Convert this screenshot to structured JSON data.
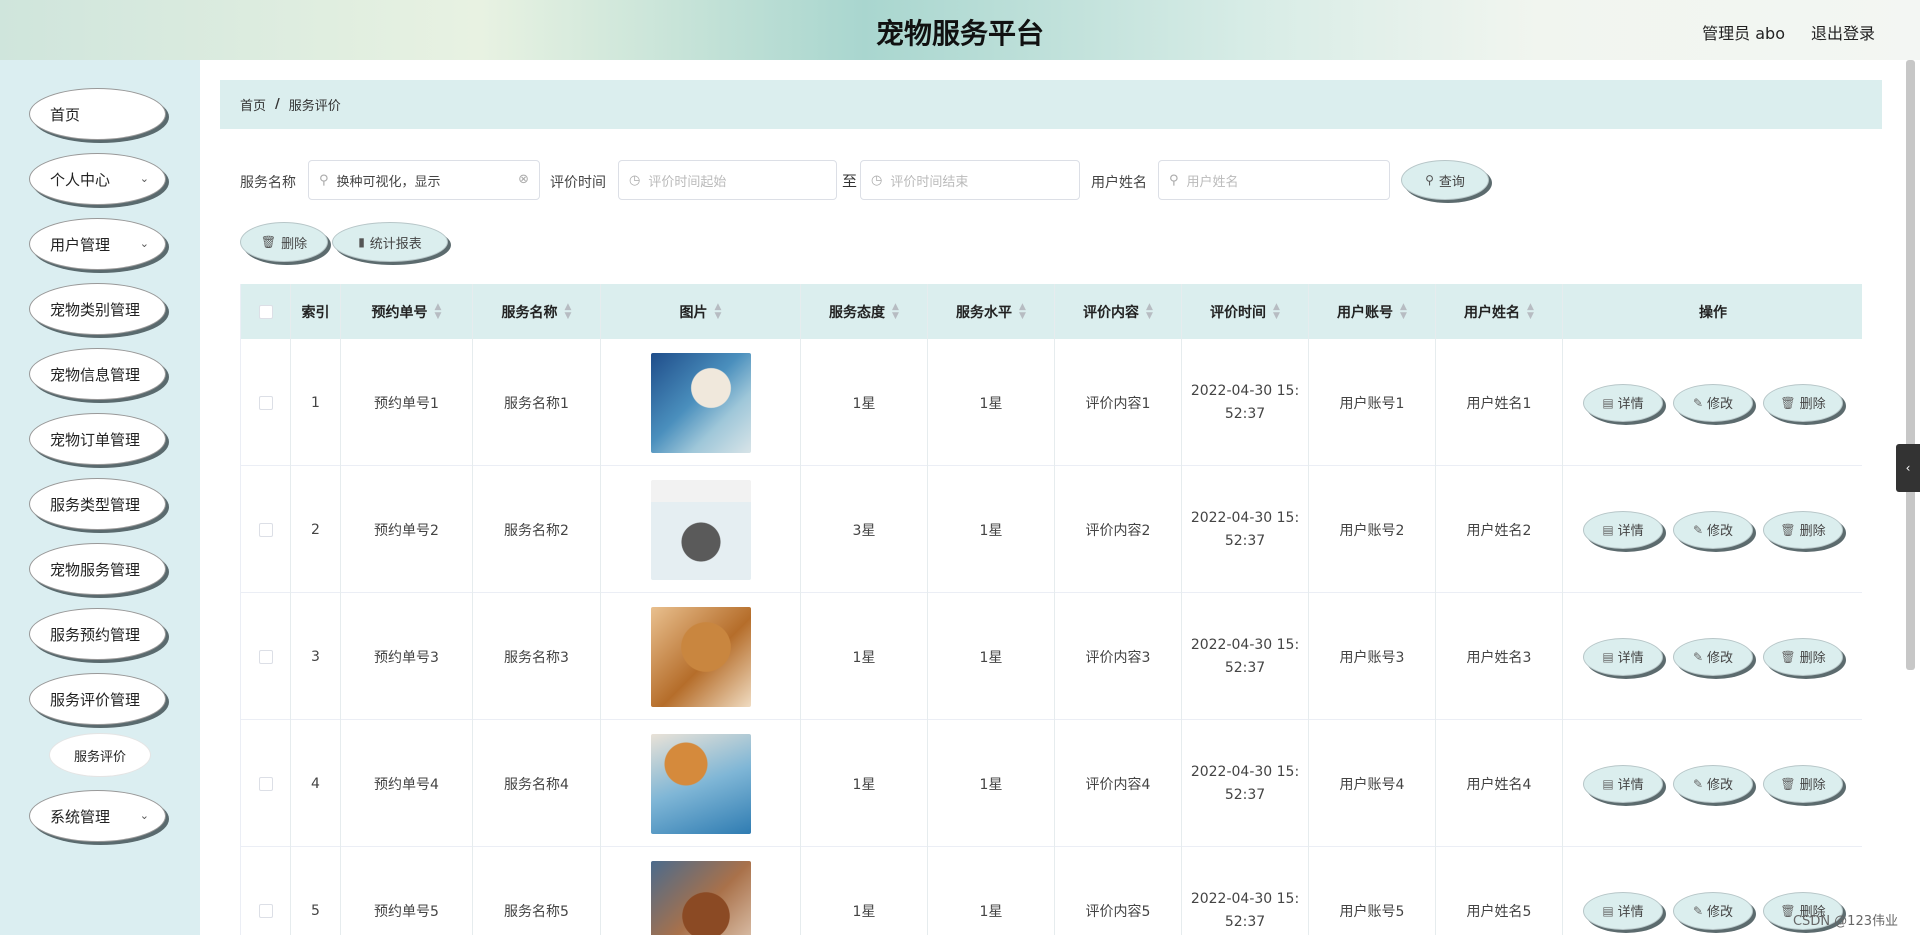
{
  "header": {
    "title": "宠物服务平台",
    "admin": "管理员 abo",
    "logout": "退出登录"
  },
  "sidebar": {
    "items": [
      {
        "label": "首页",
        "chevron": ""
      },
      {
        "label": "个人中心",
        "chevron": "⌄"
      },
      {
        "label": "用户管理",
        "chevron": "⌄"
      },
      {
        "label": "宠物类别管理",
        "chevron": ""
      },
      {
        "label": "宠物信息管理",
        "chevron": ""
      },
      {
        "label": "宠物订单管理",
        "chevron": ""
      },
      {
        "label": "服务类型管理",
        "chevron": ""
      },
      {
        "label": "宠物服务管理",
        "chevron": ""
      },
      {
        "label": "服务预约管理",
        "chevron": ""
      },
      {
        "label": "服务评价管理",
        "chevron": ""
      },
      {
        "label": "系统管理",
        "chevron": "⌄"
      }
    ],
    "sub_item": "服务评价"
  },
  "breadcrumb": {
    "home": "首页",
    "sep": "/",
    "current": "服务评价"
  },
  "search": {
    "service_name_label": "服务名称",
    "service_name_value": "换种可视化，显示",
    "time_label": "评价时间",
    "time_start_placeholder": "评价时间起始",
    "to": "至",
    "time_end_placeholder": "评价时间结束",
    "user_name_label": "用户姓名",
    "user_name_placeholder": "用户姓名",
    "query": "查询"
  },
  "toolbar": {
    "delete": "删除",
    "report": "统计报表"
  },
  "table": {
    "headers": [
      "索引",
      "预约单号",
      "服务名称",
      "图片",
      "服务态度",
      "服务水平",
      "评价内容",
      "评价时间",
      "用户账号",
      "用户姓名",
      "操作"
    ],
    "rows": [
      {
        "index": "1",
        "order": "预约单号1",
        "service": "服务名称1",
        "attitude": "1星",
        "level": "1星",
        "content": "评价内容1",
        "time": "2022-04-30 15:",
        "time2": "52:37",
        "account": "用户账号1",
        "name": "用户姓名1"
      },
      {
        "index": "2",
        "order": "预约单号2",
        "service": "服务名称2",
        "attitude": "3星",
        "level": "1星",
        "content": "评价内容2",
        "time": "2022-04-30 15:",
        "time2": "52:37",
        "account": "用户账号2",
        "name": "用户姓名2"
      },
      {
        "index": "3",
        "order": "预约单号3",
        "service": "服务名称3",
        "attitude": "1星",
        "level": "1星",
        "content": "评价内容3",
        "time": "2022-04-30 15:",
        "time2": "52:37",
        "account": "用户账号3",
        "name": "用户姓名3"
      },
      {
        "index": "4",
        "order": "预约单号4",
        "service": "服务名称4",
        "attitude": "1星",
        "level": "1星",
        "content": "评价内容4",
        "time": "2022-04-30 15:",
        "time2": "52:37",
        "account": "用户账号4",
        "name": "用户姓名4"
      },
      {
        "index": "5",
        "order": "预约单号5",
        "service": "服务名称5",
        "attitude": "1星",
        "level": "1星",
        "content": "评价内容5",
        "time": "2022-04-30 15:",
        "time2": "52:37",
        "account": "用户账号5",
        "name": "用户姓名5"
      }
    ],
    "actions": {
      "detail": "详情",
      "edit": "修改",
      "delete": "删除"
    }
  },
  "watermark": "CSDN @123伟业",
  "icons": {
    "search": "search-icon",
    "clock": "clock-icon",
    "trash": "trash-icon",
    "chart": "bar-chart-icon",
    "doc": "document-icon",
    "pen": "pencil-icon"
  }
}
